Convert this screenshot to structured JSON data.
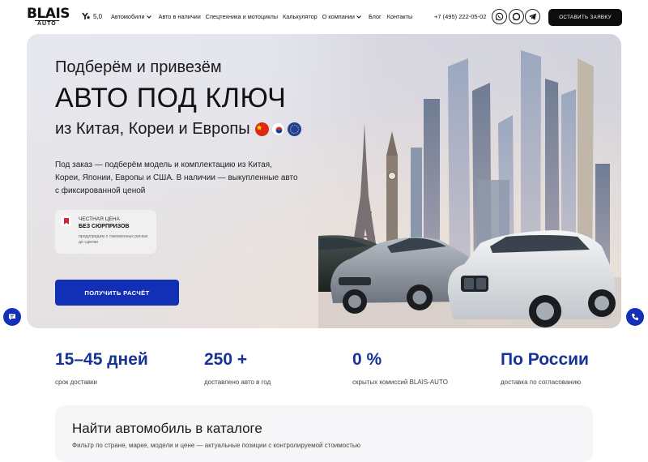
{
  "brand": {
    "name": "BLAIS",
    "sub": "AUTO"
  },
  "rating": {
    "value": "5,0",
    "icon": "yandex-icon"
  },
  "nav": [
    {
      "label": "Автомобили",
      "dropdown": true
    },
    {
      "label": "Авто в наличии",
      "dropdown": false
    },
    {
      "label": "Спецтехника и мотоциклы",
      "dropdown": false
    },
    {
      "label": "Калькулятор",
      "dropdown": false
    },
    {
      "label": "О компании",
      "dropdown": true
    },
    {
      "label": "Блог",
      "dropdown": false
    },
    {
      "label": "Контакты",
      "dropdown": false
    }
  ],
  "phone": "+7 (495) 222-05-02",
  "social": [
    "whatsapp-icon",
    "max-icon",
    "telegram-icon"
  ],
  "cta_top": "ОСТАВИТЬ ЗАЯВКУ",
  "hero": {
    "subtitle": "Подберём и привезём",
    "title": "АВТО ПОД КЛЮЧ",
    "line3": "из Китая, Кореи и Европы",
    "flags": [
      "china-flag-icon",
      "korea-flag-icon",
      "eu-flag-icon"
    ],
    "description": "Под заказ — подберём модель и комплектацию из Китая, Кореи, Японии, Европы и США. В наличии — выкупленные авто с фиксированной ценой",
    "badge": {
      "line1": "ЧЕСТНАЯ ЦЕНА",
      "line2": "БЕЗ СЮРПРИЗОВ",
      "line3": "предупредим о таможенных рисках до сделки"
    },
    "button": "ПОЛУЧИТЬ РАСЧЁТ"
  },
  "stats": [
    {
      "value": "15–45 дней",
      "caption": "срок доставки"
    },
    {
      "value": "250 +",
      "caption": "доставлено авто в год"
    },
    {
      "value": "0 %",
      "caption": "скрытых комиссий BLAIS-AUTO"
    },
    {
      "value": "По России",
      "caption": "доставка по согласованию"
    }
  ],
  "catalog": {
    "title": "Найти автомобиль в каталоге",
    "subtitle": "Фильтр по стране, марке, модели и цене — актуальные позиции с контролируемой стоимостью"
  },
  "colors": {
    "accent": "#1230b5",
    "stat": "#16339a",
    "dark": "#0d0d0d"
  }
}
